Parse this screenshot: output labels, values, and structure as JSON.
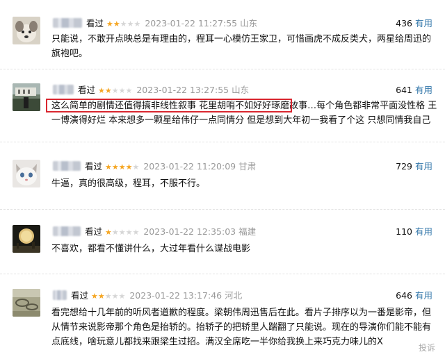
{
  "reviews": [
    {
      "seen": "看过",
      "rating": 2,
      "time": "2023-01-22 11:27:55",
      "location": "山东",
      "votes": "436",
      "useful": "有用",
      "text": "只能说，不敢开点映总是有理由的，程耳一心模仿王家卫，可惜画虎不成反类犬，两星给周迅的旗袍吧。"
    },
    {
      "seen": "看过",
      "rating": 2,
      "time": "2023-01-22 13:27:55",
      "location": "山东",
      "votes": "641",
      "useful": "有用",
      "text": "这么简单的剧情还值得搞非线性叙事 花里胡哨不如好好琢磨故事…每个角色都非常平面没性格 王一博演得好烂 本来想多一颗星给伟仔一点同情分 但是想到大年初一我看了个这 只想同情我自己"
    },
    {
      "seen": "看过",
      "rating": 4,
      "time": "2023-01-22 11:20:09",
      "location": "甘肃",
      "votes": "729",
      "useful": "有用",
      "text": "牛逼，真的很高级，程耳，不服不行。"
    },
    {
      "seen": "看过",
      "rating": 1,
      "time": "2023-01-22 12:35:03",
      "location": "福建",
      "votes": "110",
      "useful": "有用",
      "text": "不喜欢，都看不懂讲什么，大过年看什么谍战电影"
    },
    {
      "seen": "看过",
      "rating": 2,
      "time": "2023-01-22 13:17:46",
      "location": "河北",
      "votes": "646",
      "useful": "有用",
      "text": "看完想给十几年前的听风者道歉的程度。梁朝伟周迅售后在此。看片子排序以为一番是影帝，但从情节来说影帝那个角色是抬轿的。抬轿子的把轿里人踹翻了只能说。现在的导演你们能不能有点底线，啥玩意儿都找来跟梁生过招。满汉全席吃一半你给我换上来巧克力味儿的X"
    }
  ],
  "report_label": "投诉",
  "colors": {
    "star": "#f5a623",
    "useful_link": "#3377aa",
    "highlight": "#d9262f"
  }
}
